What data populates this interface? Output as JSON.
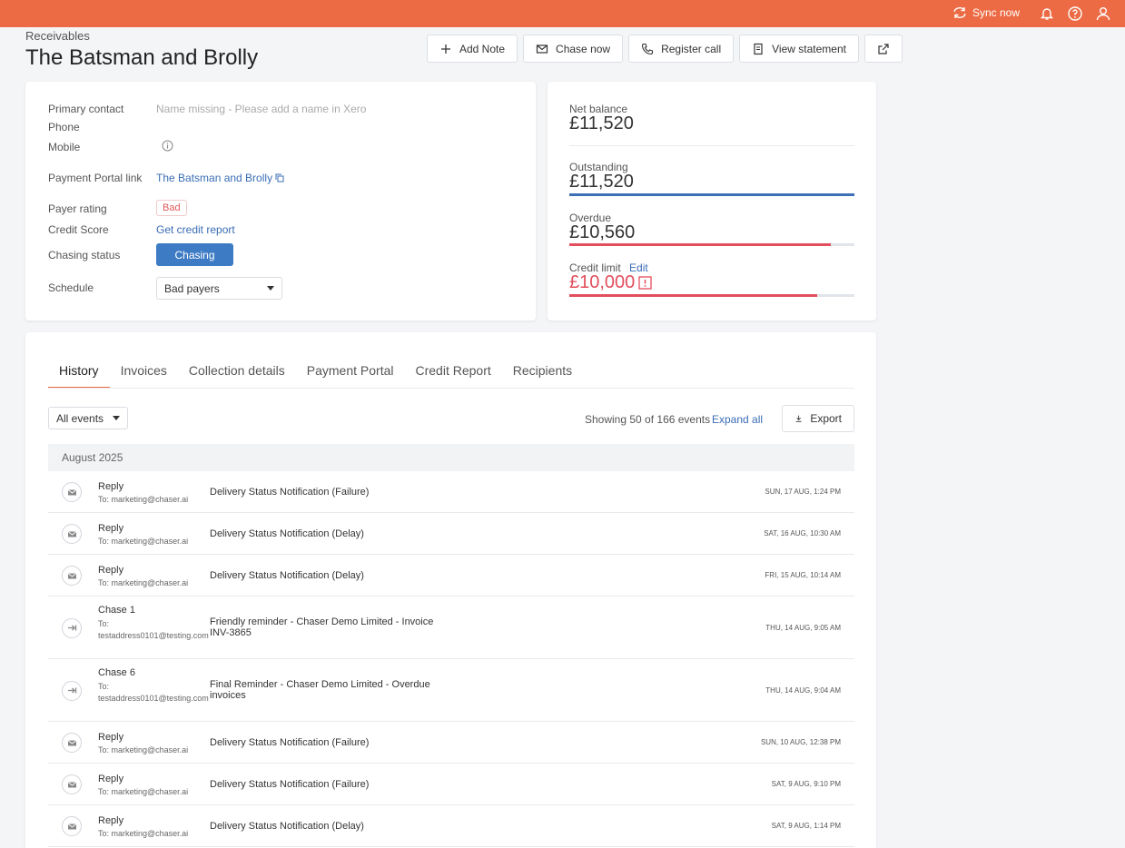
{
  "topbar": {
    "sync_label": "Sync now",
    "accent": "#ec6b44"
  },
  "breadcrumb": "Receivables",
  "title": "The Batsman and Brolly",
  "actions": {
    "add_note": "Add Note",
    "chase_now": "Chase now",
    "register_call": "Register call",
    "view_statement": "View statement"
  },
  "contact": {
    "primary_contact_label": "Primary contact",
    "primary_contact_value": "Name missing - Please add a name in Xero",
    "phone_label": "Phone",
    "mobile_label": "Mobile",
    "portal_label": "Payment Portal link",
    "portal_value": "The Batsman and Brolly",
    "payer_rating_label": "Payer rating",
    "payer_rating_value": "Bad",
    "credit_score_label": "Credit Score",
    "credit_score_value": "Get credit report",
    "chasing_status_label": "Chasing status",
    "chasing_status_value": "Chasing",
    "schedule_label": "Schedule",
    "schedule_value": "Bad payers"
  },
  "balance": {
    "net_label": "Net balance",
    "net_value": "£11,520",
    "outstanding_label": "Outstanding",
    "outstanding_value": "£11,520",
    "outstanding_fraction": 1.0,
    "overdue_label": "Overdue",
    "overdue_value": "£10,560",
    "overdue_fraction": 0.917,
    "credit_limit_label": "Credit limit",
    "credit_limit_edit": "Edit",
    "credit_limit_value": "£10,000",
    "credit_limit_fraction": 0.868,
    "blue": "#3d6fb6",
    "red": "#e24e5b"
  },
  "tabs": [
    "History",
    "Invoices",
    "Collection details",
    "Payment Portal",
    "Credit Report",
    "Recipients"
  ],
  "history": {
    "filter": "All events",
    "summary": "Showing 50 of 166 events",
    "expand": "Expand all",
    "export": "Export",
    "month": "August 2025",
    "rows": [
      {
        "type": "reply",
        "title": "Reply",
        "to": "To: marketing@chaser.ai",
        "subject": "Delivery Status Notification (Failure)",
        "time": "SUN, 17 AUG, 1:24 PM"
      },
      {
        "type": "reply",
        "title": "Reply",
        "to": "To: marketing@chaser.ai",
        "subject": "Delivery Status Notification (Delay)",
        "time": "SAT, 16 AUG, 10:30 AM"
      },
      {
        "type": "reply",
        "title": "Reply",
        "to": "To: marketing@chaser.ai",
        "subject": "Delivery Status Notification (Delay)",
        "time": "FRI, 15 AUG, 10:14 AM"
      },
      {
        "type": "chase",
        "title": "Chase 1",
        "to": "To: testaddress0101@testing.com",
        "subject": "Friendly reminder - Chaser Demo Limited - Invoice INV-3865",
        "time": "THU, 14 AUG, 9:05 AM"
      },
      {
        "type": "chase",
        "title": "Chase 6",
        "to": "To: testaddress0101@testing.com",
        "subject": "Final Reminder - Chaser Demo Limited - Overdue invoices",
        "time": "THU, 14 AUG, 9:04 AM"
      },
      {
        "type": "reply",
        "title": "Reply",
        "to": "To: marketing@chaser.ai",
        "subject": "Delivery Status Notification (Failure)",
        "time": "SUN, 10 AUG, 12:38 PM"
      },
      {
        "type": "reply",
        "title": "Reply",
        "to": "To: marketing@chaser.ai",
        "subject": "Delivery Status Notification (Failure)",
        "time": "SAT, 9 AUG, 9:10 PM"
      },
      {
        "type": "reply",
        "title": "Reply",
        "to": "To: marketing@chaser.ai",
        "subject": "Delivery Status Notification (Delay)",
        "time": "SAT, 9 AUG, 1:14 PM"
      }
    ]
  }
}
